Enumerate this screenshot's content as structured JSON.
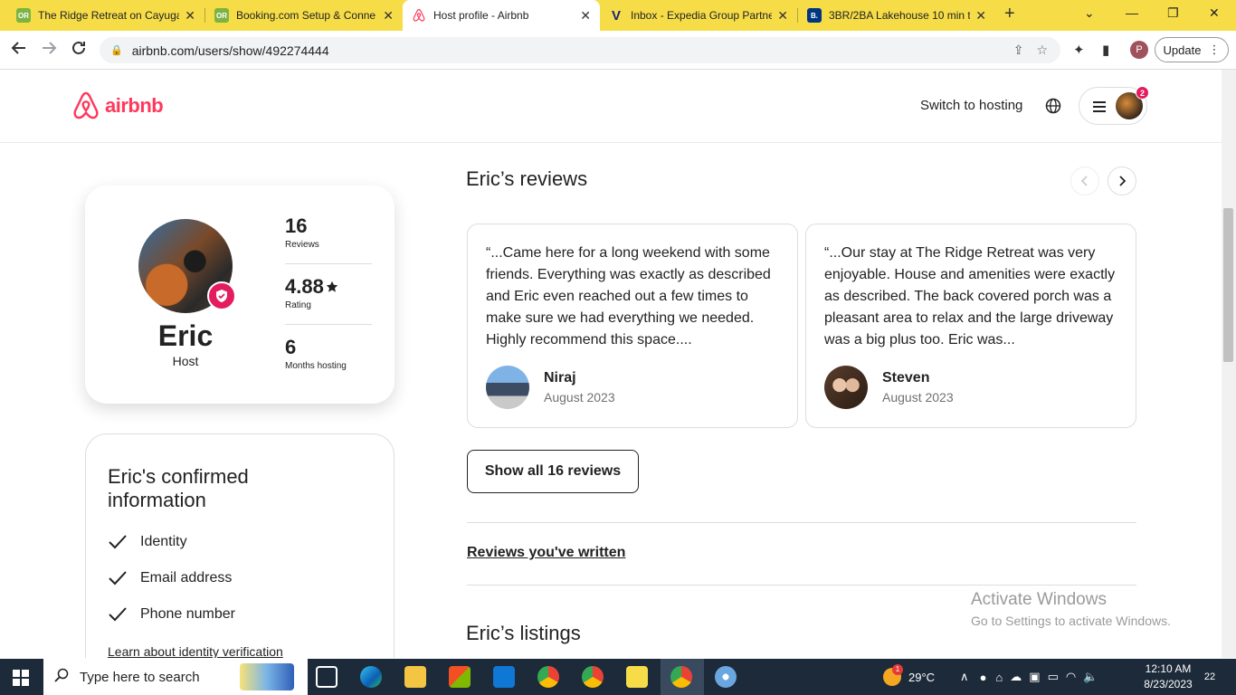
{
  "browser": {
    "tabs": [
      {
        "favicon": "OR",
        "favicon_color": "#7cb342",
        "title": "The Ridge Retreat on Cayuga",
        "active": false
      },
      {
        "favicon": "OR",
        "favicon_color": "#7cb342",
        "title": "Booking.com Setup & Conne",
        "active": false
      },
      {
        "favicon": "airbnb-icon",
        "favicon_color": "#ff385c",
        "title": "Host profile - Airbnb",
        "active": true
      },
      {
        "favicon": "V",
        "favicon_color": "#1a237e",
        "title": "Inbox - Expedia Group Partne",
        "active": false
      },
      {
        "favicon": "B.",
        "favicon_color": "#003580",
        "title": "3BR/2BA Lakehouse 10 min t",
        "active": false
      }
    ],
    "new_tab_label": "+",
    "url": "airbnb.com/users/show/492274444",
    "profile_initial": "P",
    "update_label": "Update"
  },
  "header": {
    "logo_text": "airbnb",
    "switch_hosting": "Switch to hosting",
    "notification_count": "2"
  },
  "profile": {
    "name": "Eric",
    "role": "Host",
    "stats": [
      {
        "value": "16",
        "label": "Reviews",
        "star": false
      },
      {
        "value": "4.88",
        "label": "Rating",
        "star": true
      },
      {
        "value": "6",
        "label": "Months hosting",
        "star": false
      }
    ]
  },
  "confirmed": {
    "title": "Eric's confirmed information",
    "items": [
      "Identity",
      "Email address",
      "Phone number"
    ],
    "learn_link": "Learn about identity verification"
  },
  "reviews": {
    "title": "Eric’s reviews",
    "items": [
      {
        "text": "“...Came here for a long weekend with some friends. Everything was exactly as described and Eric even reached out a few times to make sure we had everything we needed. Highly recommend this space....",
        "name": "Niraj",
        "date": "August 2023"
      },
      {
        "text": "“...Our stay at The Ridge Retreat was very enjoyable. House and amenities were exactly as described. The back covered porch was a pleasant area to relax and the large driveway was a big plus too. Eric was...",
        "name": "Steven",
        "date": "August 2023"
      }
    ],
    "show_all": "Show all 16 reviews",
    "written_link": "Reviews you've written"
  },
  "listings": {
    "title": "Eric’s listings"
  },
  "watermark": {
    "line1": "Activate Windows",
    "line2": "Go to Settings to activate Windows."
  },
  "taskbar": {
    "search_placeholder": "Type here to search",
    "temperature": "29°C",
    "weather_badge": "1",
    "time": "12:10 AM",
    "date": "8/23/2023",
    "notifications": "22"
  }
}
